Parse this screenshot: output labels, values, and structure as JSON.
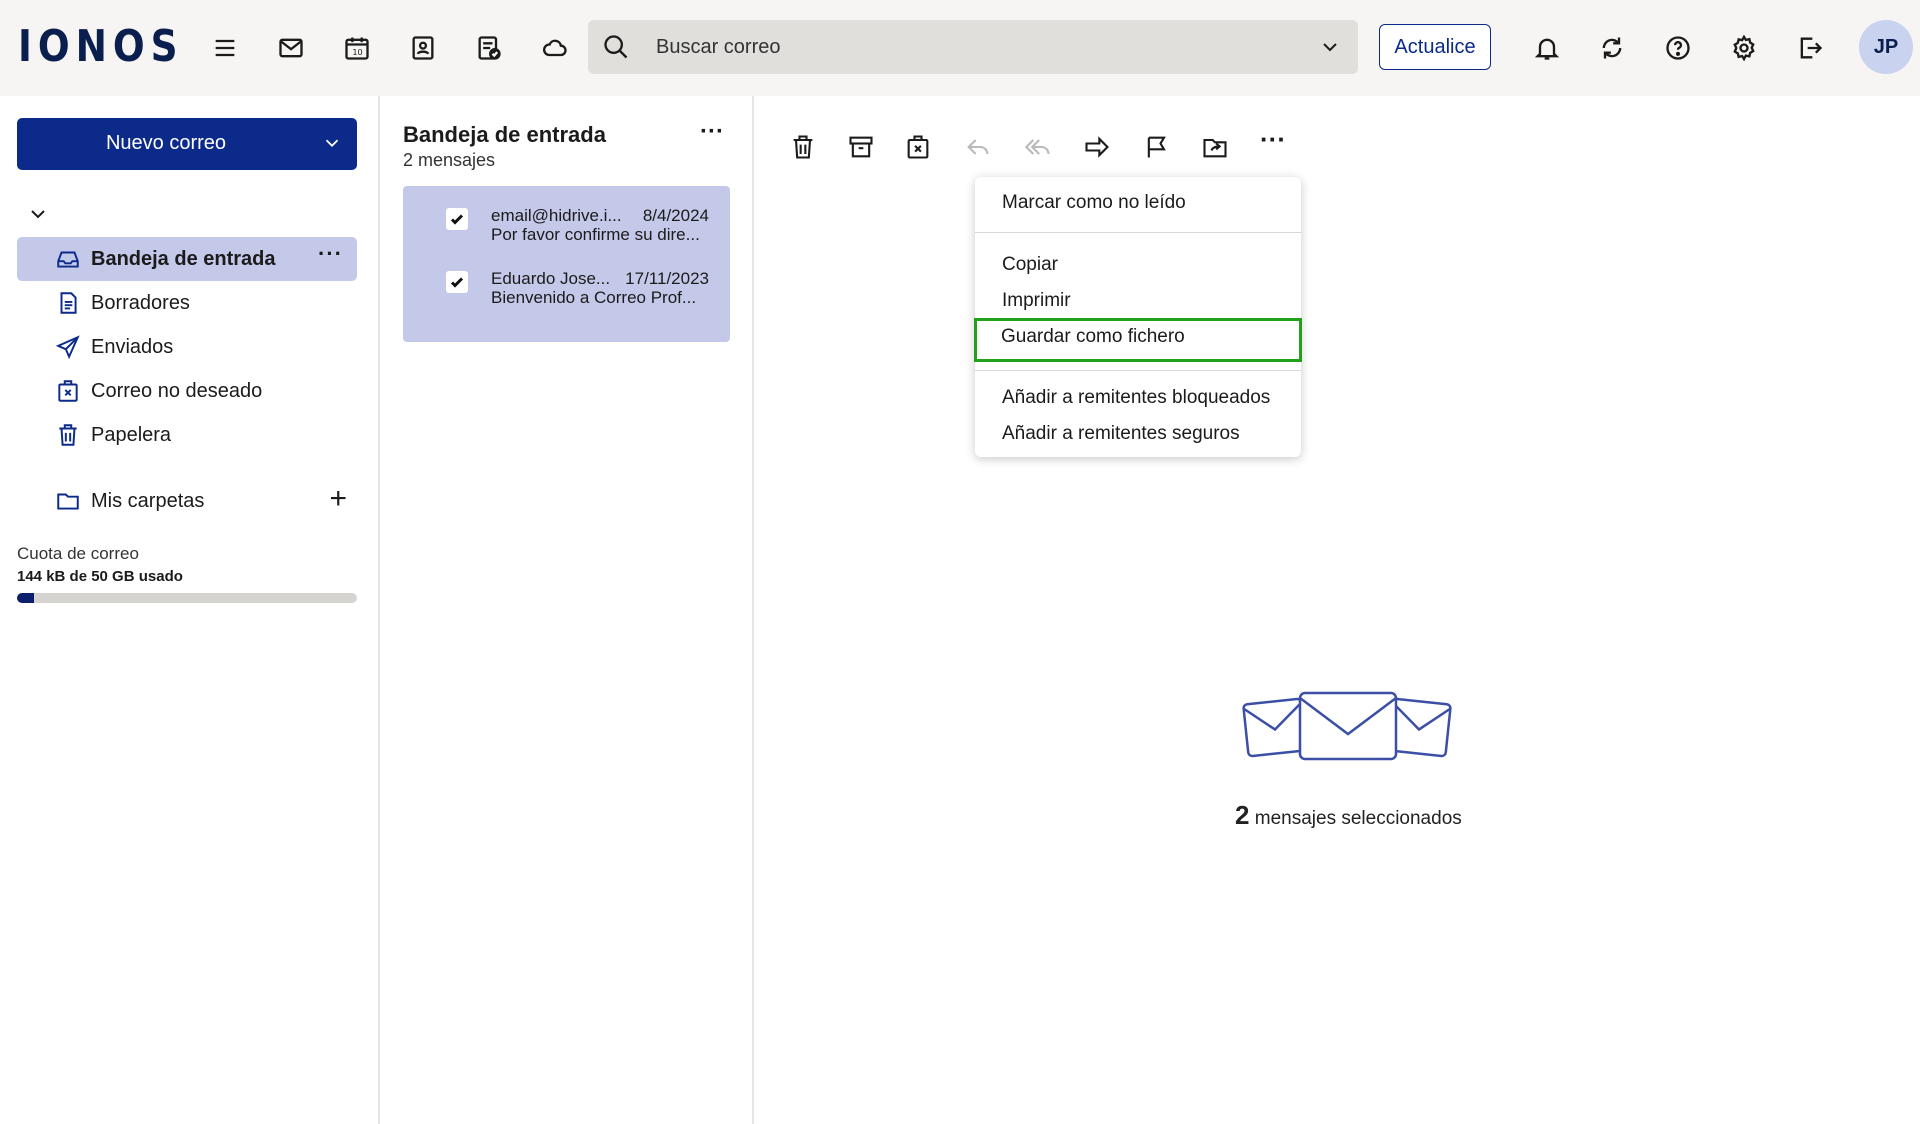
{
  "topbar": {
    "logo": "IONOS",
    "search_placeholder": "Buscar correo",
    "upgrade_label": "Actualice",
    "avatar_initials": "JP"
  },
  "sidebar": {
    "new_mail_label": "Nuevo correo",
    "folders": [
      {
        "label": "Bandeja de entrada",
        "icon": "inbox-icon",
        "active": true
      },
      {
        "label": "Borradores",
        "icon": "drafts-icon"
      },
      {
        "label": "Enviados",
        "icon": "sent-icon"
      },
      {
        "label": "Correo no deseado",
        "icon": "spam-icon"
      },
      {
        "label": "Papelera",
        "icon": "trash-icon"
      }
    ],
    "my_folders_label": "Mis carpetas",
    "quota_label": "Cuota de correo",
    "quota_value": "144 kB de 50 GB usado",
    "quota_fraction": 0.05
  },
  "message_list": {
    "title": "Bandeja de entrada",
    "count": "2 mensajes",
    "messages": [
      {
        "sender": "email@hidrive.i...",
        "date": "8/4/2024",
        "subject": "Por favor confirme su dire...",
        "checked": true
      },
      {
        "sender": "Eduardo Jose...",
        "date": "17/11/2023",
        "subject": "Bienvenido a Correo Prof...",
        "checked": true
      }
    ]
  },
  "context_menu": {
    "items": [
      "Marcar como no leído",
      "Copiar",
      "Imprimir",
      "Guardar como fichero",
      "Añadir a remitentes bloqueados",
      "Añadir a remitentes seguros"
    ],
    "highlighted": "Guardar como fichero"
  },
  "selection": {
    "count": "2",
    "label": "mensajes seleccionados"
  },
  "colors": {
    "brand": "#0b2a8a",
    "active_bg": "#c4c9ea",
    "highlight_outline": "#22a018"
  }
}
